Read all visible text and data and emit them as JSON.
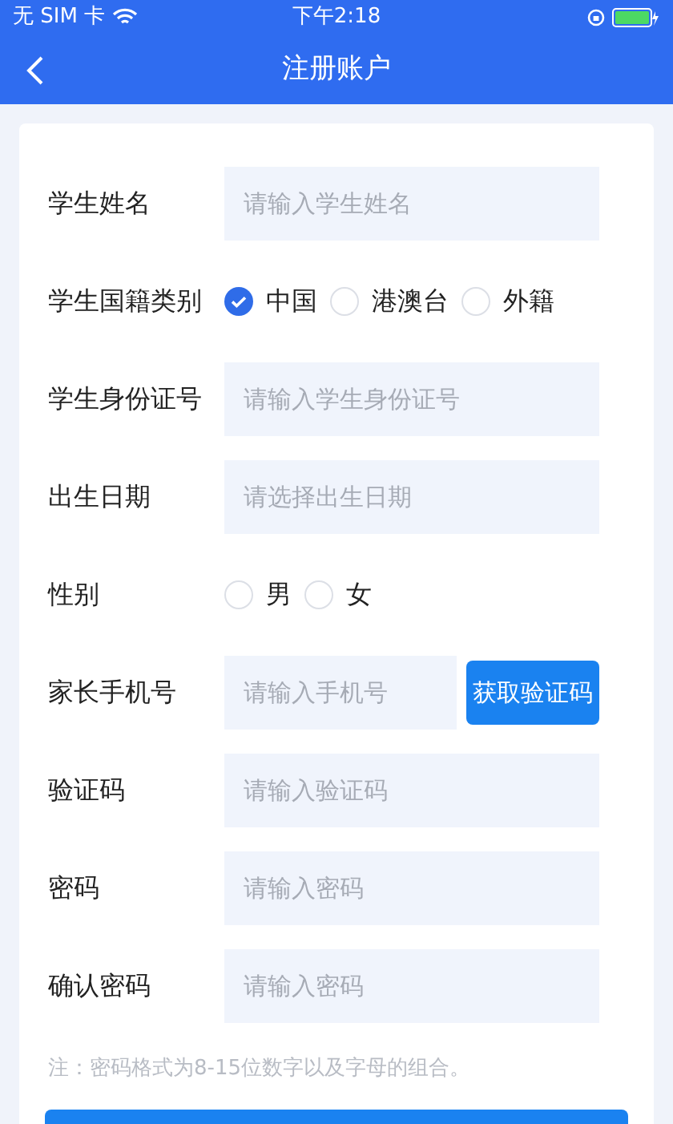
{
  "status_bar": {
    "carrier": "无 SIM 卡",
    "time": "下午2:18"
  },
  "nav": {
    "title": "注册账户"
  },
  "rows": [
    {
      "kind": "input",
      "label": "学生姓名",
      "placeholder": "请输入学生姓名"
    },
    {
      "kind": "radio",
      "label": "学生国籍类别",
      "options": [
        {
          "label": "中国",
          "selected": true
        },
        {
          "label": "港澳台",
          "selected": false
        },
        {
          "label": "外籍",
          "selected": false
        }
      ]
    },
    {
      "kind": "input",
      "label": "学生身份证号",
      "placeholder": "请输入学生身份证号"
    },
    {
      "kind": "input",
      "label": "出生日期",
      "placeholder": "请选择出生日期"
    },
    {
      "kind": "radio",
      "label": "性别",
      "options": [
        {
          "label": "男",
          "selected": false
        },
        {
          "label": "女",
          "selected": false
        }
      ]
    },
    {
      "kind": "code",
      "label": "家长手机号",
      "placeholder": "请输入手机号",
      "button": "获取验证码"
    },
    {
      "kind": "input",
      "label": "验证码",
      "placeholder": "请输入验证码"
    },
    {
      "kind": "input",
      "label": "密码",
      "placeholder": "请输入密码"
    },
    {
      "kind": "input",
      "label": "确认密码",
      "placeholder": "请输入密码"
    }
  ],
  "note": "注：密码格式为8-15位数字以及字母的组合。"
}
